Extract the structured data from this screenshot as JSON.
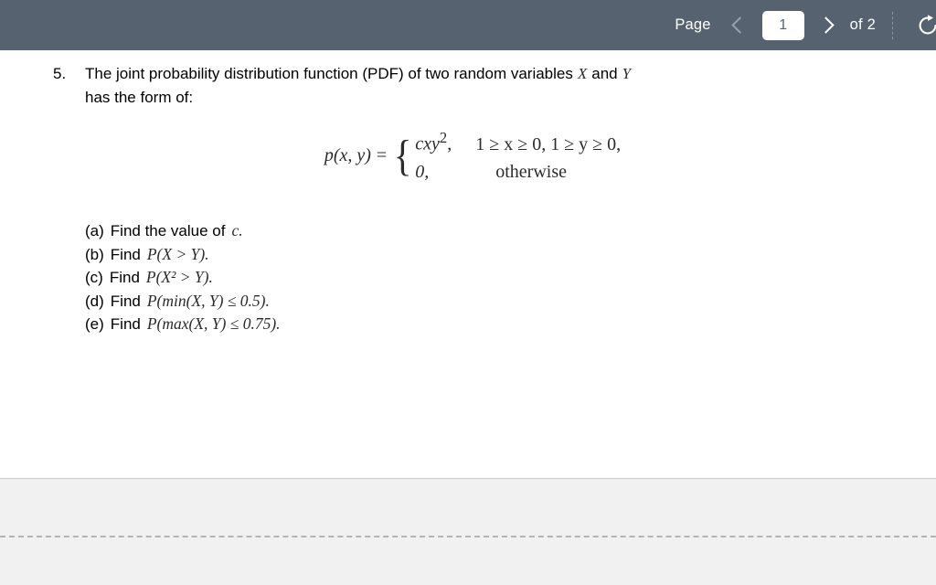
{
  "toolbar": {
    "page_label": "Page",
    "prev_icon": "chevron-left-icon",
    "page_value": "1",
    "page_placeholder": "1",
    "next_icon": "chevron-right-icon",
    "total_label": "of 2",
    "rotate_icon": "rotate-clockwise-icon",
    "background_color": "#566270",
    "text_color": "#ffffff",
    "prev_disabled_color": "#98a1ab"
  },
  "document": {
    "question": {
      "number": "5.",
      "line1_part1": "The joint probability distribution function (PDF) of two random variables",
      "var_x": "X",
      "conjunction": "and",
      "var_y": "Y",
      "line2": "has the form of:"
    },
    "formula": {
      "lhs": "p(x, y)",
      "equals": "=",
      "brace": "{",
      "case1_value": "cxy",
      "case1_exponent": "2",
      "case1_comma": ",",
      "case1_condition": "1 ≥ x ≥ 0,  1 ≥ y ≥ 0,",
      "case2_value": "0,",
      "case2_condition": "otherwise"
    },
    "subquestions": [
      {
        "marker": "(a)",
        "verb": "Find the value of",
        "math": "c."
      },
      {
        "marker": "(b)",
        "verb": "Find",
        "math": "P(X > Y)."
      },
      {
        "marker": "(c)",
        "verb": "Find",
        "math": "P(X² > Y)."
      },
      {
        "marker": "(d)",
        "verb": "Find",
        "math": "P(min(X, Y) ≤ 0.5)."
      },
      {
        "marker": "(e)",
        "verb": "Find",
        "math": "P(max(X, Y) ≤ 0.75)."
      }
    ],
    "page_background": "#ffffff",
    "viewer_background": "#f1f1f1"
  }
}
